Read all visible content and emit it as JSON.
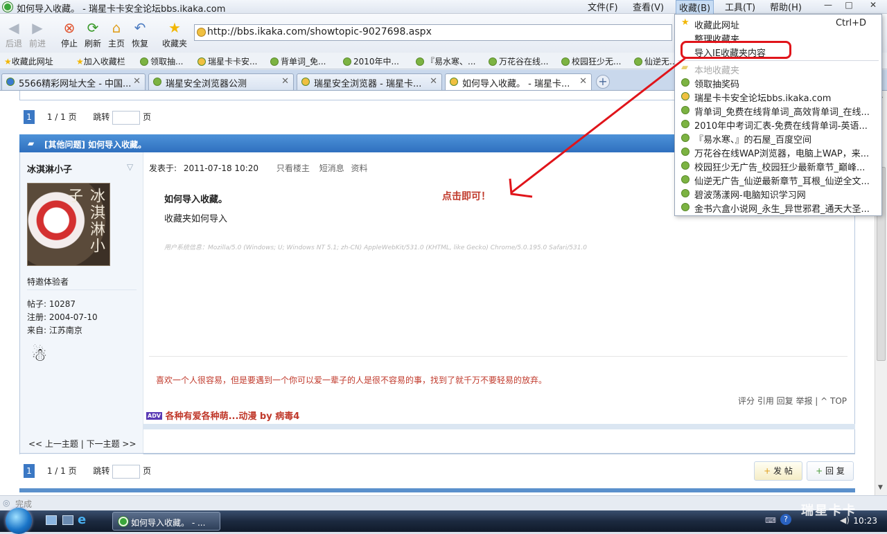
{
  "window": {
    "title": "如何导入收藏。 - 瑞星卡卡安全论坛bbs.ikaka.com"
  },
  "menu": {
    "file": "文件(F)",
    "view": "查看(V)",
    "favorites": "收藏(B)",
    "tools": "工具(T)",
    "help": "帮助(H)"
  },
  "winbtns": {
    "min": "—",
    "max": "□",
    "close": "✕"
  },
  "toolbar": {
    "back": "后退",
    "forward": "前进",
    "stop": "停止",
    "refresh": "刷新",
    "home": "主页",
    "restore": "恢复",
    "favorites": "收藏夹"
  },
  "address": {
    "url": "http://bbs.ikaka.com/showtopic-9027698.aspx"
  },
  "bookmarks": [
    "收藏此网址",
    "加入收藏栏",
    "领取抽...",
    "瑞星卡卡安...",
    "背单词_免...",
    "2010年中...",
    "『易水寒、...",
    "万花谷在线...",
    "校园狂少无...",
    "仙逆无..."
  ],
  "tabs": [
    "5566精彩网址大全 - 中国...",
    "瑞星安全浏览器公测",
    "瑞星安全浏览器 - 瑞星卡...",
    "如何导入收藏。 - 瑞星卡..."
  ],
  "pager": {
    "page": "1",
    "of": "1 / 1 页",
    "jump": "跳转",
    "page_unit": "页"
  },
  "post": {
    "category_title": "[其他问题] 如何导入收藏。",
    "author": "冰淇淋小子",
    "posted_label": "发表于:",
    "posted_at": "2011-07-18 10:20",
    "only_author": "只看楼主",
    "message": "短消息",
    "profile": "资料",
    "title": "如何导入收藏。",
    "body": "收藏夹如何导入",
    "user_agent": "用户系统信息：Mozilla/5.0 (Windows; U; Windows NT 5.1; zh-CN) AppleWebKit/531.0 (KHTML, like Gecko) Chrome/5.0.195.0 Safari/531.0",
    "signature": "喜欢一个人很容易，但是要遇到一个你可以爱一辈子的人是很不容易的事，找到了就千万不要轻易的放弃。",
    "actions": "评分  引用  回复 举报 | ^ TOP",
    "adv_badge": "ADV",
    "adv_text": "各种有爱各种萌...动漫  by 病毒4"
  },
  "user": {
    "rank": "特邀体验者",
    "posts": "帖子: 10287",
    "registered": "注册:  2004-07-10",
    "from": "来自: 江苏南京",
    "avatar_text": "冰淇淋小子"
  },
  "prevnext": "<< 上一主题 | 下一主题 >>",
  "buttons": {
    "new_post": "发 帖",
    "reply": "回 复"
  },
  "annotation": "点击即可！",
  "dropdown": {
    "items": [
      {
        "label": "收藏此网址",
        "shortcut": "Ctrl+D"
      },
      {
        "label": "整理收藏夹"
      },
      {
        "label": "导入IE收藏夹内容"
      }
    ],
    "local_header": "本地收藏夹",
    "bookmarks": [
      "领取抽奖码",
      "瑞星卡卡安全论坛bbs.ikaka.com",
      "背单词_免费在线背单词_高效背单词_在线...",
      "2010年中考词汇表-免费在线背单词-英语...",
      "『易水寒、』的石屋_百度空间",
      "万花谷在线WAP浏览器，电脑上WAP，来...",
      "校园狂少无广告_校园狂少最新章节_巅峰...",
      "仙逆无广告_仙逆最新章节_耳根_仙逆全文...",
      "碧波荡漾网-电脑知识学习网",
      "金书六盒小说网_永生_异世邪君_通天大圣..."
    ]
  },
  "status": {
    "text": "完成"
  },
  "taskbar": {
    "task": "如何导入收藏。 - ...",
    "clock": "10:23"
  },
  "watermark": "瑞星卡卡"
}
